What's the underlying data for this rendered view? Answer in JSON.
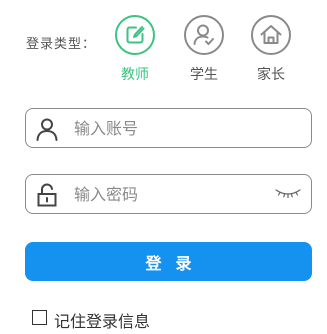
{
  "login_type": {
    "label": "登录类型：",
    "roles": [
      {
        "key": "teacher",
        "label": "教师",
        "icon": "edit-square-icon",
        "selected": true
      },
      {
        "key": "student",
        "label": "学生",
        "icon": "user-check-icon",
        "selected": false
      },
      {
        "key": "parent",
        "label": "家长",
        "icon": "home-icon",
        "selected": false
      }
    ]
  },
  "account": {
    "placeholder": "输入账号",
    "value": "",
    "icon": "user-icon"
  },
  "password": {
    "placeholder": "输入密码",
    "value": "",
    "icon": "lock-icon",
    "toggle_icon": "eye-closed-icon"
  },
  "login_button": {
    "label": "登录"
  },
  "remember": {
    "label": "记住登录信息",
    "checked": false
  },
  "colors": {
    "accent_green": "#3cc382",
    "primary_blue": "#1591f0",
    "border_gray": "#8a8a8a"
  }
}
